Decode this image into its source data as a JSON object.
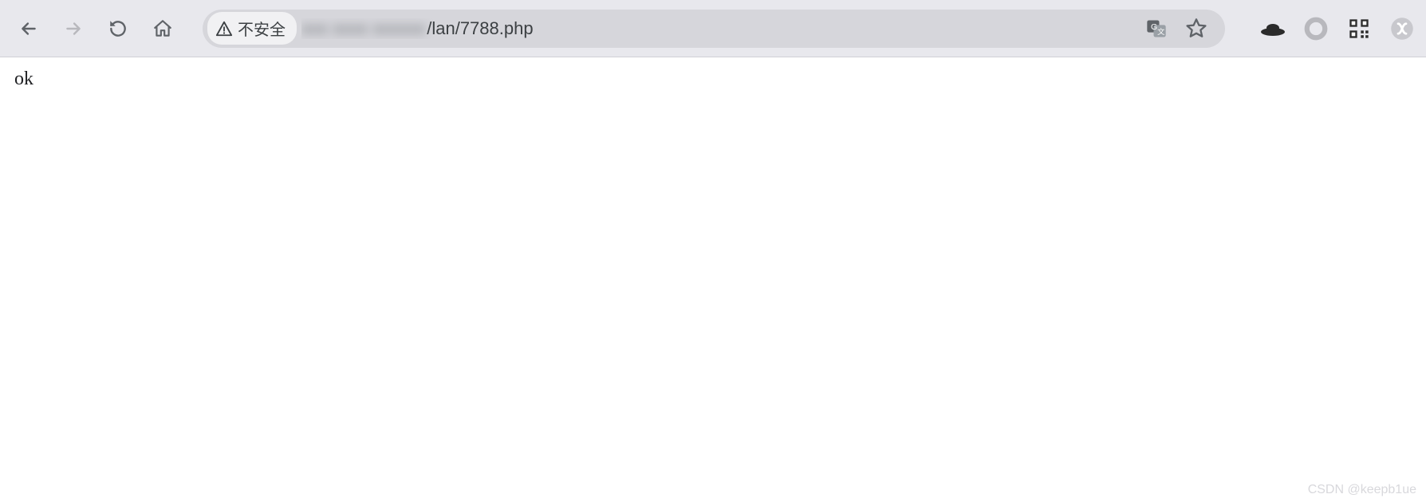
{
  "toolbar": {
    "security_label": "不安全",
    "url_hidden_part": "xxx xxxx xxxxxx",
    "url_visible_part": "/lan/7788.php"
  },
  "page": {
    "body_text": "ok"
  },
  "watermark": "CSDN @keepb1ue"
}
